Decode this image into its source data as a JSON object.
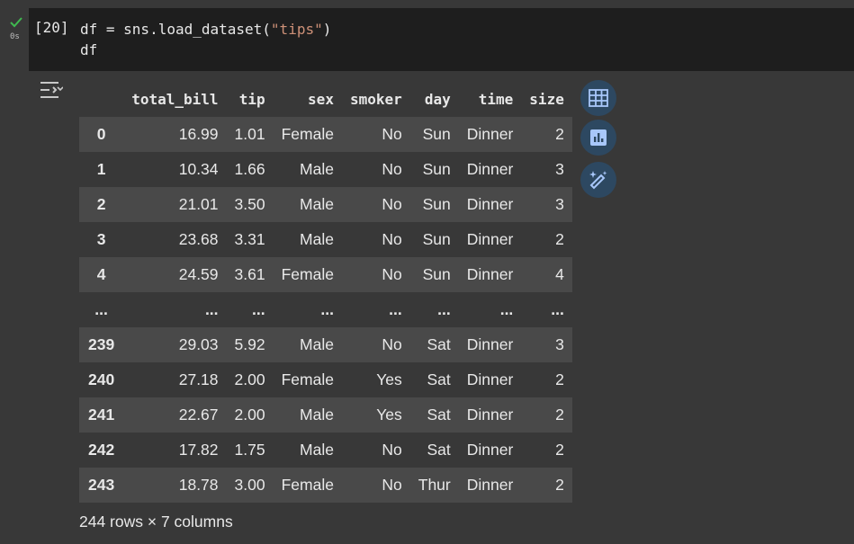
{
  "cell": {
    "status_icon": "check-icon",
    "exec_time": "0s",
    "exec_count": "[20]",
    "code": {
      "line1_pre": "df = sns.load_dataset(",
      "line1_str": "\"tips\"",
      "line1_post": ")",
      "line2": "df"
    }
  },
  "output": {
    "toggle_icon": "output-toggle-icon",
    "columns": [
      "",
      "total_bill",
      "tip",
      "sex",
      "smoker",
      "day",
      "time",
      "size"
    ],
    "rows": [
      [
        "0",
        "16.99",
        "1.01",
        "Female",
        "No",
        "Sun",
        "Dinner",
        "2"
      ],
      [
        "1",
        "10.34",
        "1.66",
        "Male",
        "No",
        "Sun",
        "Dinner",
        "3"
      ],
      [
        "2",
        "21.01",
        "3.50",
        "Male",
        "No",
        "Sun",
        "Dinner",
        "3"
      ],
      [
        "3",
        "23.68",
        "3.31",
        "Male",
        "No",
        "Sun",
        "Dinner",
        "2"
      ],
      [
        "4",
        "24.59",
        "3.61",
        "Female",
        "No",
        "Sun",
        "Dinner",
        "4"
      ],
      [
        "...",
        "...",
        "...",
        "...",
        "...",
        "...",
        "...",
        "..."
      ],
      [
        "239",
        "29.03",
        "5.92",
        "Male",
        "No",
        "Sat",
        "Dinner",
        "3"
      ],
      [
        "240",
        "27.18",
        "2.00",
        "Female",
        "Yes",
        "Sat",
        "Dinner",
        "2"
      ],
      [
        "241",
        "22.67",
        "2.00",
        "Male",
        "Yes",
        "Sat",
        "Dinner",
        "2"
      ],
      [
        "242",
        "17.82",
        "1.75",
        "Male",
        "No",
        "Sat",
        "Dinner",
        "2"
      ],
      [
        "243",
        "18.78",
        "3.00",
        "Female",
        "No",
        "Thur",
        "Dinner",
        "2"
      ]
    ],
    "summary": "244 rows × 7 columns",
    "side_buttons": [
      "table-view-icon",
      "chart-suggest-icon",
      "magic-edit-icon"
    ]
  },
  "colors": {
    "background": "#383838",
    "code_background": "#1e1e1e",
    "row_stripe": "#494949",
    "success": "#3fb950",
    "button_bg": "#2d4861",
    "button_icon": "#a8c7fa"
  }
}
